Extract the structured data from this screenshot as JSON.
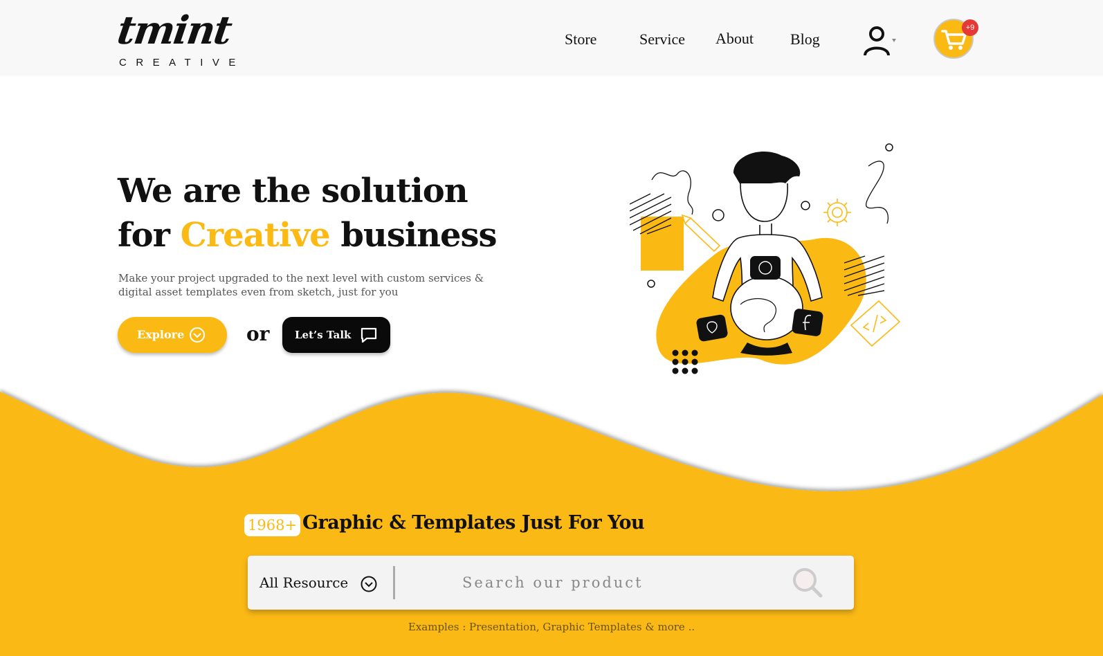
{
  "header": {
    "logo": {
      "word": "tmint",
      "sub": "CREATIVE"
    },
    "nav": [
      "Store",
      "Service",
      "About",
      "Blog"
    ],
    "cart_badge": "+9",
    "icons": [
      "user-icon",
      "cart-icon"
    ]
  },
  "hero": {
    "title_line1": "We are the solution",
    "title_line2_pre": "for ",
    "title_line2_accent": "Creative",
    "title_line2_post": " business",
    "subtitle": "Make your project upgraded to the next level with custom services & digital asset templates even from sketch, just for you",
    "explore_label": "Explore",
    "or_label": "or",
    "talk_label": "Let’s Talk"
  },
  "section": {
    "count": "1968+",
    "title": "Graphic & Templates Just For You",
    "select_label": "All Resource",
    "search_placeholder": "Search our product",
    "examples": "Examples : Presentation, Graphic Templates & more .."
  },
  "colors": {
    "accent": "#fbb913",
    "dark": "#0a0a0a",
    "badge": "#e53935",
    "header_bg": "#f8f8f8"
  }
}
